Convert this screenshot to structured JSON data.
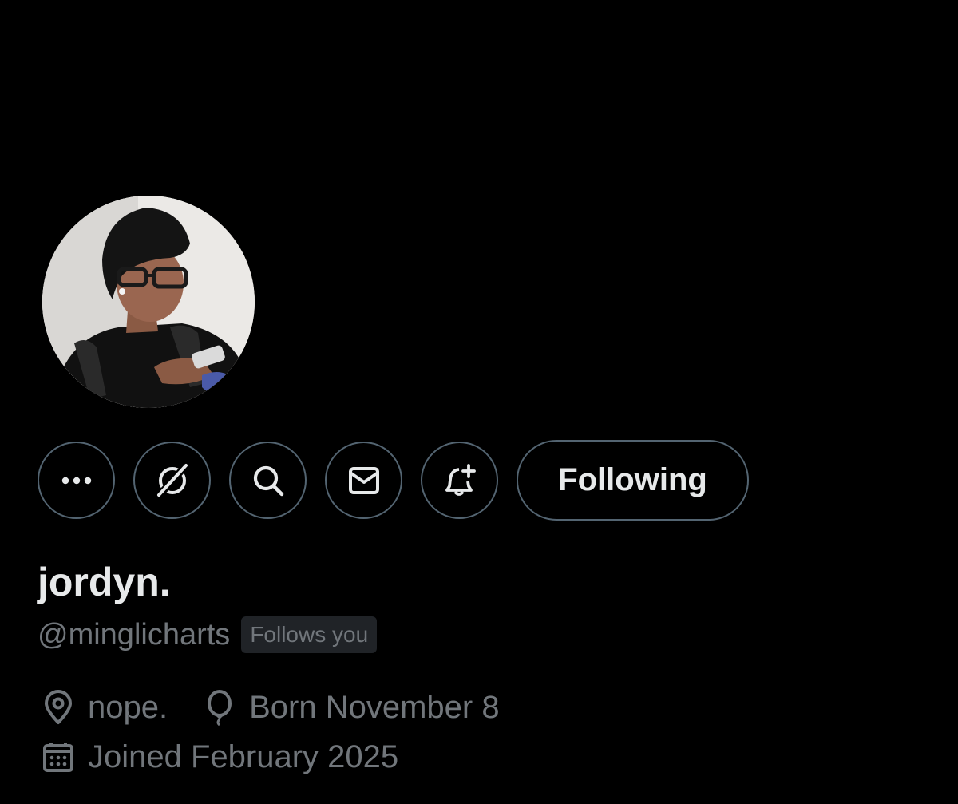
{
  "profile": {
    "display_name": "jordyn.",
    "handle": "@minglicharts",
    "follows_you_badge": "Follows you",
    "avatar_icon": "profile-photo"
  },
  "actions": {
    "more_icon": "more-dots-icon",
    "grok_icon": "grok-icon",
    "search_icon": "search-icon",
    "message_icon": "mail-icon",
    "notify_icon": "bell-plus-icon",
    "following_label": "Following"
  },
  "meta": {
    "location": "nope.",
    "birthday": "Born November 8",
    "joined": "Joined February 2025"
  },
  "colors": {
    "background": "#000000",
    "primary_text": "#e7e9ea",
    "secondary_text": "#71767b",
    "border": "#536471",
    "badge_bg": "#202327"
  }
}
